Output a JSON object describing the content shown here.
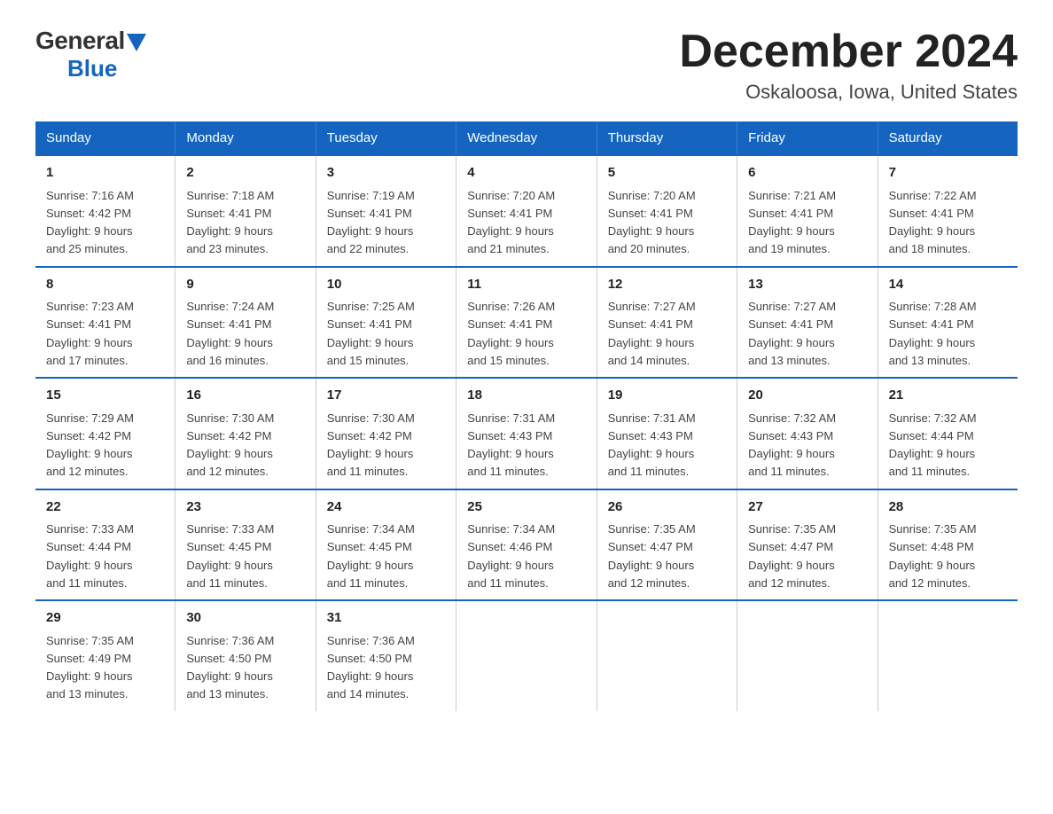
{
  "header": {
    "logo_general": "General",
    "logo_blue": "Blue",
    "month_title": "December 2024",
    "location": "Oskaloosa, Iowa, United States"
  },
  "weekdays": [
    "Sunday",
    "Monday",
    "Tuesday",
    "Wednesday",
    "Thursday",
    "Friday",
    "Saturday"
  ],
  "weeks": [
    [
      {
        "day": "1",
        "sunrise": "7:16 AM",
        "sunset": "4:42 PM",
        "daylight": "9 hours and 25 minutes."
      },
      {
        "day": "2",
        "sunrise": "7:18 AM",
        "sunset": "4:41 PM",
        "daylight": "9 hours and 23 minutes."
      },
      {
        "day": "3",
        "sunrise": "7:19 AM",
        "sunset": "4:41 PM",
        "daylight": "9 hours and 22 minutes."
      },
      {
        "day": "4",
        "sunrise": "7:20 AM",
        "sunset": "4:41 PM",
        "daylight": "9 hours and 21 minutes."
      },
      {
        "day": "5",
        "sunrise": "7:20 AM",
        "sunset": "4:41 PM",
        "daylight": "9 hours and 20 minutes."
      },
      {
        "day": "6",
        "sunrise": "7:21 AM",
        "sunset": "4:41 PM",
        "daylight": "9 hours and 19 minutes."
      },
      {
        "day": "7",
        "sunrise": "7:22 AM",
        "sunset": "4:41 PM",
        "daylight": "9 hours and 18 minutes."
      }
    ],
    [
      {
        "day": "8",
        "sunrise": "7:23 AM",
        "sunset": "4:41 PM",
        "daylight": "9 hours and 17 minutes."
      },
      {
        "day": "9",
        "sunrise": "7:24 AM",
        "sunset": "4:41 PM",
        "daylight": "9 hours and 16 minutes."
      },
      {
        "day": "10",
        "sunrise": "7:25 AM",
        "sunset": "4:41 PM",
        "daylight": "9 hours and 15 minutes."
      },
      {
        "day": "11",
        "sunrise": "7:26 AM",
        "sunset": "4:41 PM",
        "daylight": "9 hours and 15 minutes."
      },
      {
        "day": "12",
        "sunrise": "7:27 AM",
        "sunset": "4:41 PM",
        "daylight": "9 hours and 14 minutes."
      },
      {
        "day": "13",
        "sunrise": "7:27 AM",
        "sunset": "4:41 PM",
        "daylight": "9 hours and 13 minutes."
      },
      {
        "day": "14",
        "sunrise": "7:28 AM",
        "sunset": "4:41 PM",
        "daylight": "9 hours and 13 minutes."
      }
    ],
    [
      {
        "day": "15",
        "sunrise": "7:29 AM",
        "sunset": "4:42 PM",
        "daylight": "9 hours and 12 minutes."
      },
      {
        "day": "16",
        "sunrise": "7:30 AM",
        "sunset": "4:42 PM",
        "daylight": "9 hours and 12 minutes."
      },
      {
        "day": "17",
        "sunrise": "7:30 AM",
        "sunset": "4:42 PM",
        "daylight": "9 hours and 11 minutes."
      },
      {
        "day": "18",
        "sunrise": "7:31 AM",
        "sunset": "4:43 PM",
        "daylight": "9 hours and 11 minutes."
      },
      {
        "day": "19",
        "sunrise": "7:31 AM",
        "sunset": "4:43 PM",
        "daylight": "9 hours and 11 minutes."
      },
      {
        "day": "20",
        "sunrise": "7:32 AM",
        "sunset": "4:43 PM",
        "daylight": "9 hours and 11 minutes."
      },
      {
        "day": "21",
        "sunrise": "7:32 AM",
        "sunset": "4:44 PM",
        "daylight": "9 hours and 11 minutes."
      }
    ],
    [
      {
        "day": "22",
        "sunrise": "7:33 AM",
        "sunset": "4:44 PM",
        "daylight": "9 hours and 11 minutes."
      },
      {
        "day": "23",
        "sunrise": "7:33 AM",
        "sunset": "4:45 PM",
        "daylight": "9 hours and 11 minutes."
      },
      {
        "day": "24",
        "sunrise": "7:34 AM",
        "sunset": "4:45 PM",
        "daylight": "9 hours and 11 minutes."
      },
      {
        "day": "25",
        "sunrise": "7:34 AM",
        "sunset": "4:46 PM",
        "daylight": "9 hours and 11 minutes."
      },
      {
        "day": "26",
        "sunrise": "7:35 AM",
        "sunset": "4:47 PM",
        "daylight": "9 hours and 12 minutes."
      },
      {
        "day": "27",
        "sunrise": "7:35 AM",
        "sunset": "4:47 PM",
        "daylight": "9 hours and 12 minutes."
      },
      {
        "day": "28",
        "sunrise": "7:35 AM",
        "sunset": "4:48 PM",
        "daylight": "9 hours and 12 minutes."
      }
    ],
    [
      {
        "day": "29",
        "sunrise": "7:35 AM",
        "sunset": "4:49 PM",
        "daylight": "9 hours and 13 minutes."
      },
      {
        "day": "30",
        "sunrise": "7:36 AM",
        "sunset": "4:50 PM",
        "daylight": "9 hours and 13 minutes."
      },
      {
        "day": "31",
        "sunrise": "7:36 AM",
        "sunset": "4:50 PM",
        "daylight": "9 hours and 14 minutes."
      },
      null,
      null,
      null,
      null
    ]
  ],
  "labels": {
    "sunrise": "Sunrise:",
    "sunset": "Sunset:",
    "daylight": "Daylight:"
  }
}
